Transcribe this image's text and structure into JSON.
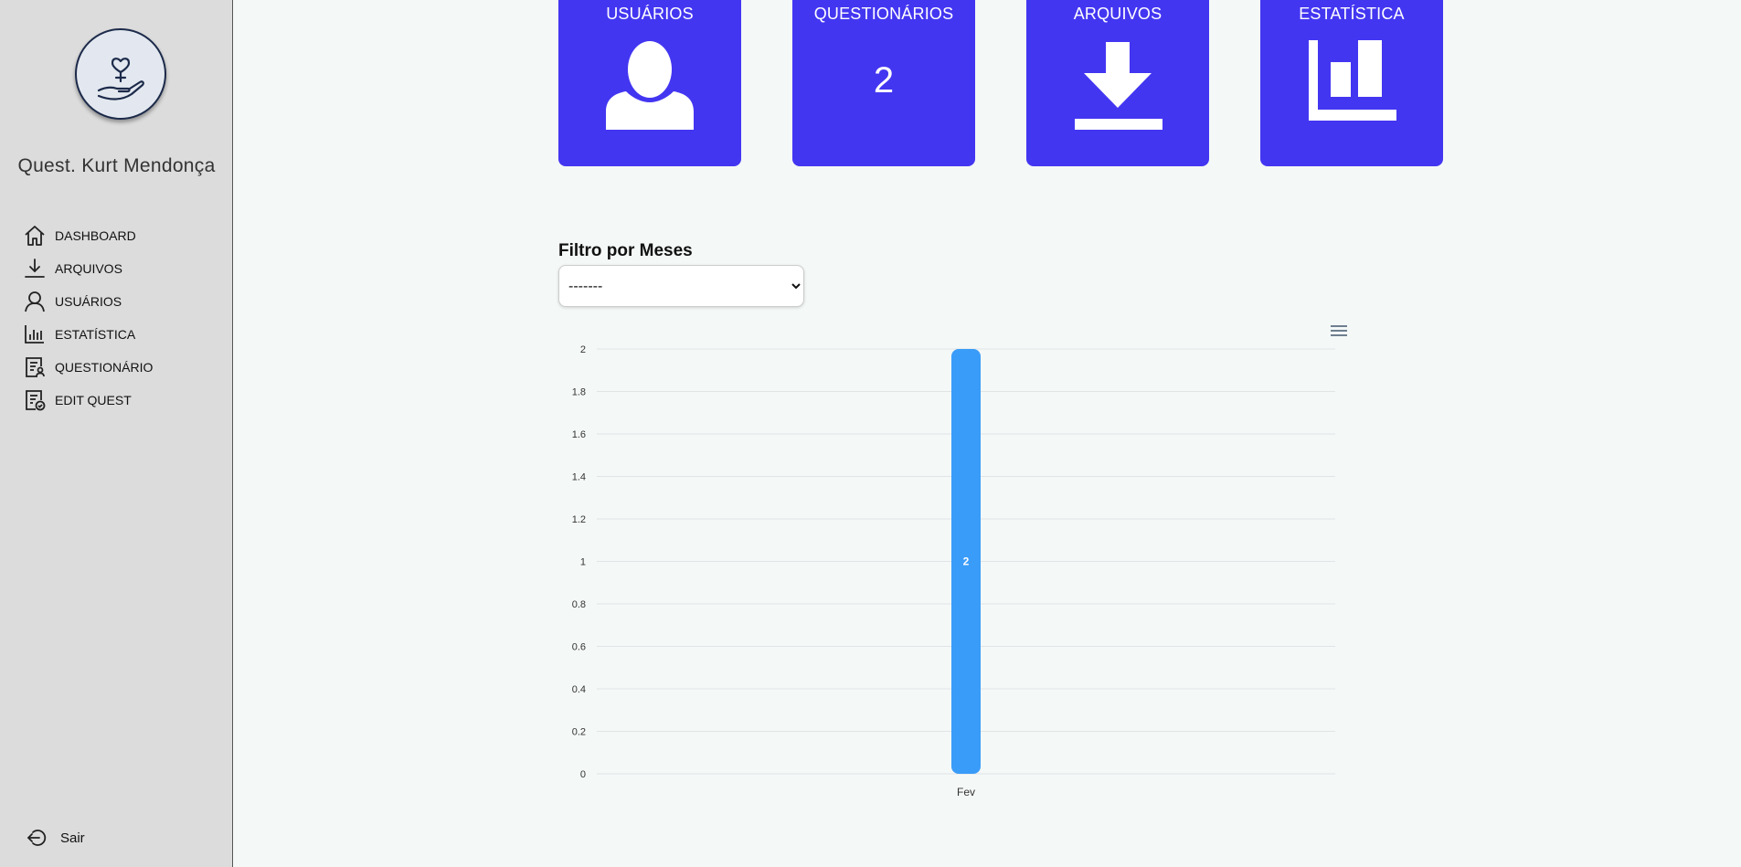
{
  "sidebar": {
    "app_title": "Quest. Kurt Mendonça",
    "items": [
      {
        "label": "DASHBOARD",
        "icon": "home-icon"
      },
      {
        "label": "ARQUIVOS",
        "icon": "download-icon"
      },
      {
        "label": "USUÁRIOS",
        "icon": "user-icon"
      },
      {
        "label": "ESTATÍSTICA",
        "icon": "bar-chart-icon"
      },
      {
        "label": "QUESTIONÁRIO",
        "icon": "document-user-icon"
      },
      {
        "label": "EDIT QUEST",
        "icon": "document-check-icon"
      }
    ],
    "logout_label": "Sair"
  },
  "cards": [
    {
      "title": "USUÁRIOS",
      "icon": "user-icon"
    },
    {
      "title": "QUESTIONÁRIOS",
      "value": "2"
    },
    {
      "title": "ARQUIVOS",
      "icon": "download-icon"
    },
    {
      "title": "ESTATÍSTICA",
      "icon": "bar-chart-icon"
    }
  ],
  "filter": {
    "label": "Filtro por Meses",
    "selected": "-------"
  },
  "colors": {
    "card": "#4336f1",
    "bar": "#3a9cf9",
    "sidebar": "#dcdcdc",
    "background": "#f4f8f7"
  },
  "chart_data": {
    "type": "bar",
    "categories": [
      "Fev"
    ],
    "values": [
      2
    ],
    "ylim": [
      0,
      2
    ],
    "yticks": [
      "0",
      "0.2",
      "0.4",
      "0.6",
      "0.8",
      "1",
      "1.2",
      "1.4",
      "1.6",
      "1.8",
      "2"
    ],
    "data_labels": [
      "2"
    ],
    "grid": true
  }
}
